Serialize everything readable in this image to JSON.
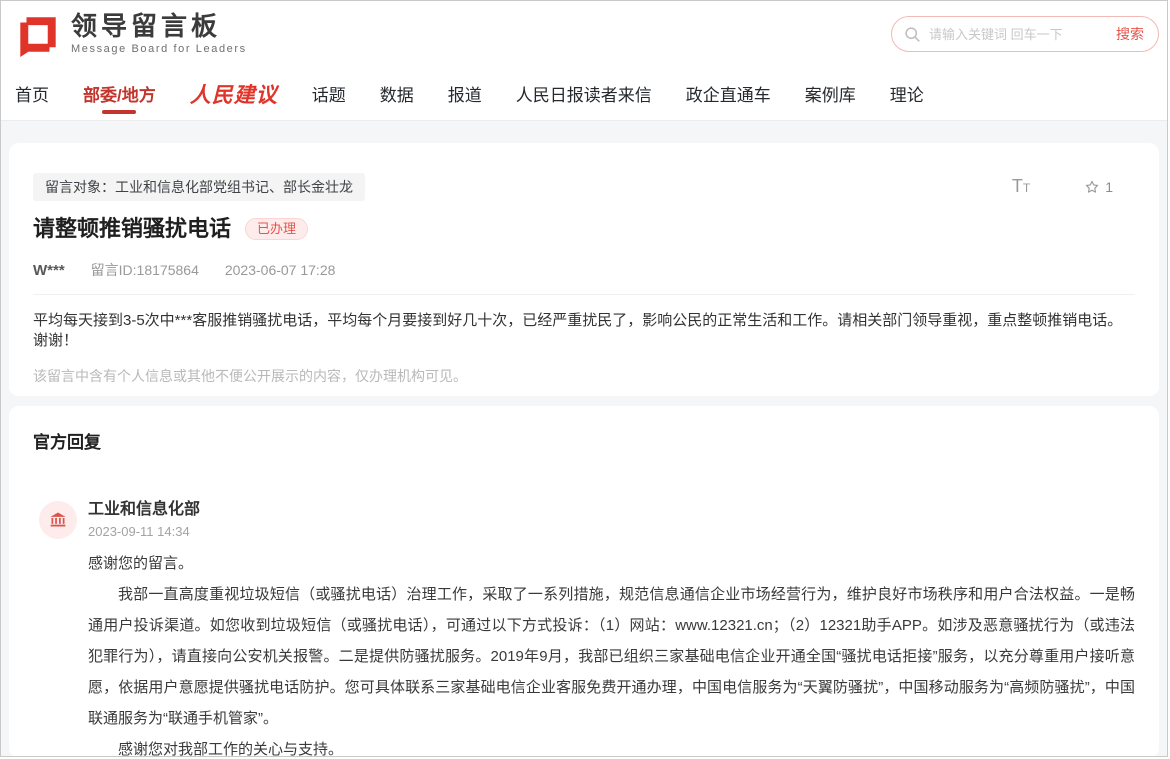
{
  "header": {
    "logo": {
      "title": "领导留言板",
      "subtitle": "Message Board for Leaders"
    },
    "search": {
      "placeholder": "请输入关键词 回车一下",
      "button_label": "搜索"
    }
  },
  "nav": {
    "items": [
      {
        "label": "首页"
      },
      {
        "label": "部委/地方",
        "active": true
      },
      {
        "label": "人民建议",
        "brand": true
      },
      {
        "label": "话题"
      },
      {
        "label": "数据"
      },
      {
        "label": "报道"
      },
      {
        "label": "人民日报读者来信"
      },
      {
        "label": "政企直通车"
      },
      {
        "label": "案例库"
      },
      {
        "label": "理论"
      }
    ]
  },
  "message": {
    "target_label": "留言对象：工业和信息化部党组书记、部长金壮龙",
    "font_tool_label": "TT",
    "favorite_count": "1",
    "title": "请整顿推销骚扰电话",
    "status_badge": "已办理",
    "author": "W***",
    "message_id": "留言ID:18175864",
    "datetime": "2023-06-07 17:28",
    "body": "平均每天接到3-5次中***客服推销骚扰电话，平均每个月要接到好几十次，已经严重扰民了，影响公民的正常生活和工作。请相关部门领导重视，重点整顿推销电话。谢谢！",
    "privacy_note": "该留言中含有个人信息或其他不便公开展示的内容，仅办理机构可见。"
  },
  "reply": {
    "section_title": "官方回复",
    "org_name": "工业和信息化部",
    "datetime": "2023-09-11 14:34",
    "paragraphs": [
      "感谢您的留言。",
      "我部一直高度重视垃圾短信（或骚扰电话）治理工作，采取了一系列措施，规范信息通信企业市场经营行为，维护良好市场秩序和用户合法权益。一是畅通用户投诉渠道。如您收到垃圾短信（或骚扰电话），可通过以下方式投诉：（1）网站：www.12321.cn；（2）12321助手APP。如涉及恶意骚扰行为（或违法犯罪行为），请直接向公安机关报警。二是提供防骚扰服务。2019年9月，我部已组织三家基础电信企业开通全国“骚扰电话拒接”服务，以充分尊重用户接听意愿，依据用户意愿提供骚扰电话防护。您可具体联系三家基础电信企业客服免费开通办理，中国电信服务为“天翼防骚扰”，中国移动服务为“高频防骚扰”，中国联通服务为“联通手机管家”。",
      "感谢您对我部工作的关心与支持。"
    ]
  },
  "colors": {
    "brand_red": "#e0342b",
    "accent_red": "#e6544a",
    "nav_active": "#c1352c",
    "badge_bg": "#fdeceb",
    "page_bg": "#f5f6f7"
  }
}
